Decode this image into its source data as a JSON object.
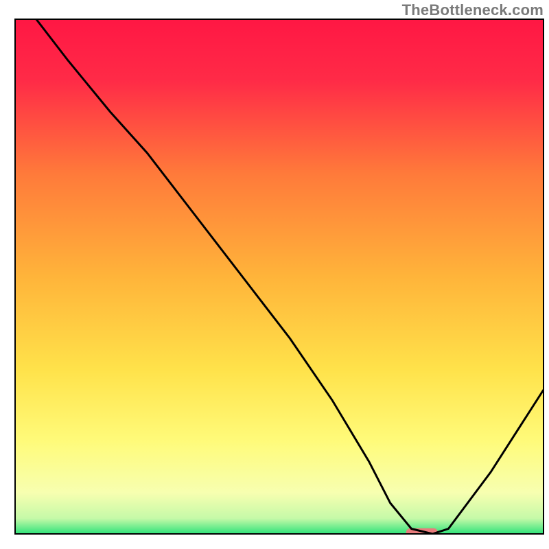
{
  "watermark": "TheBottleneck.com",
  "chart_data": {
    "type": "line",
    "title": "",
    "xlabel": "",
    "ylabel": "",
    "xlim": [
      0,
      100
    ],
    "ylim": [
      0,
      100
    ],
    "grid": false,
    "legend": false,
    "background": {
      "gradient_stops": [
        {
          "pos": 0.0,
          "color": "#ff1744"
        },
        {
          "pos": 0.12,
          "color": "#ff2b47"
        },
        {
          "pos": 0.3,
          "color": "#ff7a3a"
        },
        {
          "pos": 0.5,
          "color": "#ffb43a"
        },
        {
          "pos": 0.68,
          "color": "#ffe24a"
        },
        {
          "pos": 0.82,
          "color": "#fffb7a"
        },
        {
          "pos": 0.92,
          "color": "#f7ffb0"
        },
        {
          "pos": 0.97,
          "color": "#c5f9a8"
        },
        {
          "pos": 1.0,
          "color": "#2fe37a"
        }
      ]
    },
    "series": [
      {
        "name": "bottleneck-curve",
        "color": "#000000",
        "x": [
          4,
          10,
          18,
          25,
          34,
          43,
          52,
          60,
          67,
          71,
          75,
          79,
          82,
          90,
          100
        ],
        "y": [
          100,
          92,
          82,
          74,
          62,
          50,
          38,
          26,
          14,
          6,
          1,
          0,
          1,
          12,
          28
        ]
      }
    ],
    "marker": {
      "name": "optimal-range-marker",
      "x_center": 77,
      "y": 0.3,
      "width_x_units": 6,
      "color": "#e87c7c"
    },
    "axes_box": {
      "color": "#000000",
      "stroke_width": 2
    }
  }
}
